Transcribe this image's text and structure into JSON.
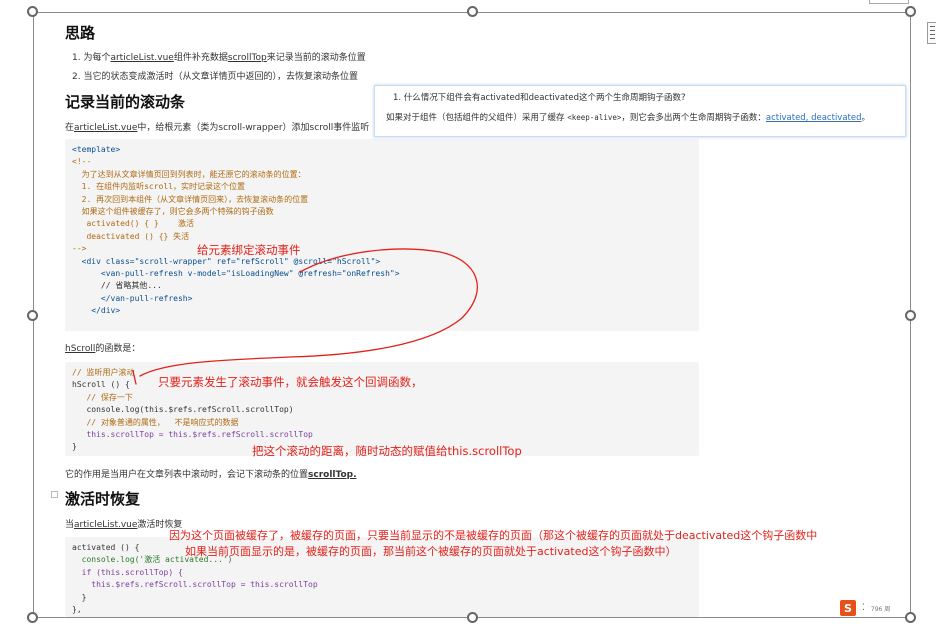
{
  "section1": {
    "title": "思路",
    "items": [
      {
        "prefix": "1. 为每个",
        "link": "articleList.vue",
        "mid": "组件补充数据",
        "link2": "scrollTop",
        "suffix": "来记录当前的滚动条位置"
      },
      {
        "text": "2. 当它的状态变成激活时（从文章详情页中返回的），去恢复滚动条位置"
      }
    ]
  },
  "section2": {
    "title": "记录当前的滚动条",
    "intro_prefix": "在",
    "intro_link": "articleList.vue",
    "intro_suffix": "中，给根元素（类为scroll-wrapper）添加scroll事件监听",
    "code_lines": [
      "<template>",
      "<!--",
      "  为了达到从文章详情页回到列表时，能还原它的滚动条的位置：",
      "  1. 在组件内监听scroll，实时记录这个位置",
      "  2. 再次回到本组件（从文章详情页回来），去恢复滚动条的位置",
      "",
      "  如果这个组件被缓存了，则它会多两个特殊的钩子函数",
      "   activated() { }    激活",
      "   deactivated () {} 失活",
      "-->",
      "  <div class=\"scroll-wrapper\" ref=\"refScroll\" @scroll=\"hScroll\">",
      "      <van-pull-refresh v-model=\"isLoadingNew\" @refresh=\"onRefresh\">",
      "      // 省略其他...",
      "      </van-pull-refresh>",
      "    </div>"
    ],
    "hscroll_prefix": "hScroll",
    "hscroll_suffix": "的函数是：",
    "code2_lines": [
      "// 监听用户滚动",
      "hScroll () {",
      "   // 保存一下",
      "   console.log(this.$refs.refScroll.scrollTop)",
      "   // 对象普通的属性，  不是响应式的数据",
      "   this.scrollTop = this.$refs.refScroll.scrollTop",
      "}"
    ],
    "effect_prefix": "它的作用是当用户在文章列表中滚动时，会记下滚动条的位置",
    "effect_link": "scrollTop."
  },
  "section3": {
    "title": "激活时恢复",
    "intro_prefix": "当",
    "intro_link": "articleList.vue",
    "intro_suffix": "激活时恢复",
    "code_lines": [
      "activated () {",
      "  console.log('激活 activated...')",
      "  if (this.scrollTop) {",
      "    this.$refs.refScroll.scrollTop = this.scrollTop",
      "  }",
      "},"
    ]
  },
  "popup": {
    "question": "1. 什么情况下组件会有activated和deactivated这个两个生命周期钩子函数?",
    "answer_prefix": "如果对于组件（包括组件的父组件）采用了缓存 ",
    "answer_code": "<keep-alive>",
    "answer_mid": "，则它会多出两个生命周期钩子函数：",
    "answer_link": "activated, deactivated",
    "answer_end": "。"
  },
  "annotations": {
    "note1": "给元素绑定滚动事件",
    "note2": "只要元素发生了滚动事件，就会触发这个回调函数，",
    "note3": "把这个滚动的距离，随时动态的赋值给this.scrollTop",
    "note4": "因为这个页面被缓存了，被缓存的页面，只要当前显示的不是被缓存的页面（那这个被缓存的页面就处于deactivated这个钩子函数中",
    "note5": "如果当前页面显示的是，被缓存的页面，那当前这个被缓存的页面就处于activated这个钩子函数中）",
    "ink_color": "#e3211b"
  },
  "status": {
    "logo": "S",
    "dots": "⁚",
    "page": "796 周"
  }
}
